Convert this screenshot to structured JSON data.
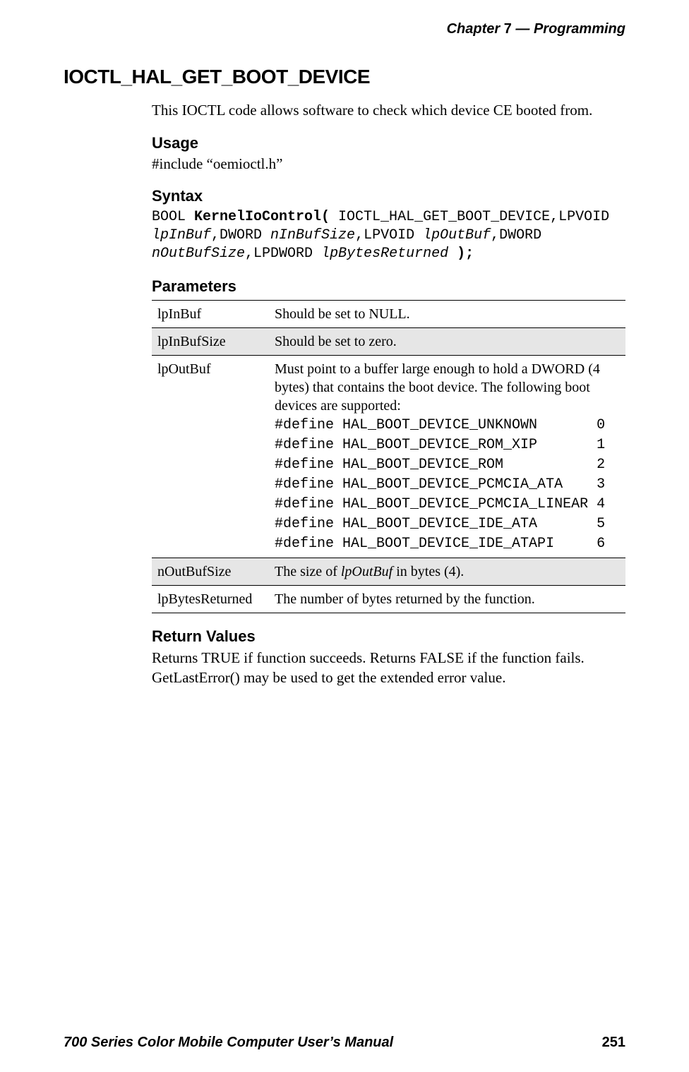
{
  "header": {
    "chapter_label": "Chapter",
    "chapter_num": "7",
    "sep": "—",
    "chapter_title": "Programming"
  },
  "title": "IOCTL_HAL_GET_BOOT_DEVICE",
  "intro": "This IOCTL code allows software to check which device CE booted from.",
  "usage": {
    "heading": "Usage",
    "line": "#include “oemioctl.h”"
  },
  "syntax": {
    "heading": "Syntax",
    "t1": "BOOL ",
    "t2": "KernelIoControl(",
    "t3": " IOCTL_HAL_GET_BOOT_DEVICE,LPVOID\n",
    "t4": "lpInBuf",
    "t5": ",DWORD ",
    "t6": "nInBufSize",
    "t7": ",LPVOID ",
    "t8": "lpOutBuf",
    "t9": ",DWORD\n",
    "t10": "nOutBufSize",
    "t11": ",LPDWORD ",
    "t12": "lpBytesReturned",
    "t13": " );"
  },
  "parameters": {
    "heading": "Parameters",
    "rows": [
      {
        "name": "lpInBuf",
        "desc_plain": "Should be set to NULL."
      },
      {
        "name": "lpInBufSize",
        "desc_plain": "Should be set to zero."
      },
      {
        "name": "lpOutBuf",
        "desc_intro": "Must point to a buffer large enough to hold a DWORD (4 bytes) that contains the boot device. The following boot devices are supported:",
        "defines": "#define HAL_BOOT_DEVICE_UNKNOWN       0\n#define HAL_BOOT_DEVICE_ROM_XIP       1\n#define HAL_BOOT_DEVICE_ROM           2\n#define HAL_BOOT_DEVICE_PCMCIA_ATA    3\n#define HAL_BOOT_DEVICE_PCMCIA_LINEAR 4\n#define HAL_BOOT_DEVICE_IDE_ATA       5\n#define HAL_BOOT_DEVICE_IDE_ATAPI     6"
      },
      {
        "name": "nOutBufSize",
        "desc_pre": "The size of ",
        "desc_ital": "lpOutBuf",
        "desc_post": " in bytes (4)."
      },
      {
        "name": "lpBytesReturned",
        "desc_plain": "The number of bytes returned by the function."
      }
    ]
  },
  "return_values": {
    "heading": "Return Values",
    "text": "Returns TRUE if function succeeds. Returns FALSE if the function fails. GetLastError() may be used to get the extended error value."
  },
  "footer": {
    "manual_title": "700 Series Color Mobile Computer User’s Manual",
    "page": "251"
  }
}
